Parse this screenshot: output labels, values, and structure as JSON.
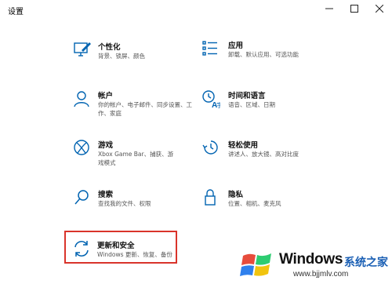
{
  "window": {
    "title": "设置",
    "minimize_icon": "minimize-icon",
    "maximize_icon": "maximize-icon",
    "close_icon": "close-icon"
  },
  "accent_color": "#0063b1",
  "highlight_color": "#d9342b",
  "categories": [
    {
      "label": "个性化",
      "desc": "背景、锁屏、颜色",
      "icon": "personalization-icon"
    },
    {
      "label": "应用",
      "desc": "卸载、默认应用、可选功能",
      "icon": "apps-icon"
    },
    {
      "label": "帐户",
      "desc": "你的帐户、电子邮件、同步设置、工作、家庭",
      "icon": "accounts-icon"
    },
    {
      "label": "时间和语言",
      "desc": "语音、区域、日期",
      "icon": "time-language-icon"
    },
    {
      "label": "游戏",
      "desc": "Xbox Game Bar、捕获、游戏模式",
      "icon": "xbox-icon"
    },
    {
      "label": "轻松使用",
      "desc": "讲述人、放大镜、高对比度",
      "icon": "ease-of-access-icon"
    },
    {
      "label": "搜索",
      "desc": "查找我的文件、权限",
      "icon": "search-icon"
    },
    {
      "label": "隐私",
      "desc": "位置、相机、麦克风",
      "icon": "lock-icon"
    },
    {
      "label": "更新和安全",
      "desc": "Windows 更新、恢复、备份",
      "icon": "update-icon"
    }
  ],
  "watermark": {
    "brand": "Windows",
    "cn": "系统之家",
    "url": "www.bjjmlv.com"
  }
}
